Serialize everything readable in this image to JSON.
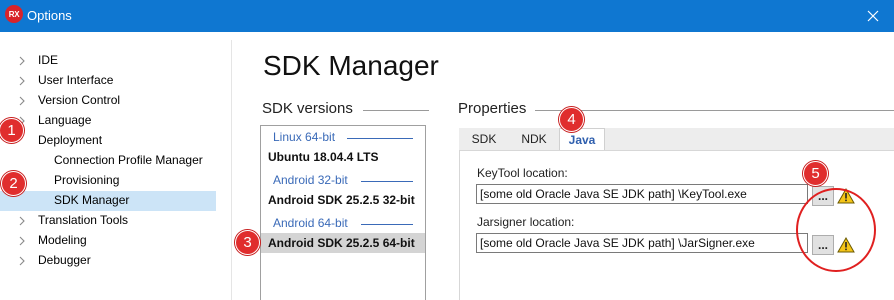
{
  "window": {
    "logo_text": "RX",
    "title": "Options"
  },
  "tree": {
    "items": [
      {
        "label": "IDE",
        "has_chevron": true
      },
      {
        "label": "User Interface",
        "has_chevron": true
      },
      {
        "label": "Version Control",
        "has_chevron": true
      },
      {
        "label": "Language",
        "has_chevron": true
      },
      {
        "label": "Deployment",
        "has_chevron": false
      },
      {
        "label": "Connection Profile Manager",
        "child": true
      },
      {
        "label": "Provisioning",
        "child": true
      },
      {
        "label": "SDK Manager",
        "child": true,
        "selected": true
      },
      {
        "label": "Translation Tools",
        "has_chevron": true
      },
      {
        "label": "Modeling",
        "has_chevron": true
      },
      {
        "label": "Debugger",
        "has_chevron": true
      }
    ]
  },
  "markers": [
    "1",
    "2",
    "3",
    "4",
    "5"
  ],
  "page": {
    "title": "SDK Manager"
  },
  "sdk_versions": {
    "heading": "SDK versions",
    "groups": [
      {
        "name": "Linux 64-bit",
        "items": [
          "Ubuntu 18.04.4 LTS"
        ]
      },
      {
        "name": "Android 32-bit",
        "items": [
          "Android SDK 25.2.5 32-bit"
        ]
      },
      {
        "name": "Android 64-bit",
        "items": [
          "Android SDK 25.2.5 64-bit"
        ]
      }
    ],
    "selected": "Android SDK 25.2.5 64-bit"
  },
  "properties": {
    "heading": "Properties",
    "tabs": [
      "SDK",
      "NDK",
      "Java"
    ],
    "active_tab": "Java",
    "fields": [
      {
        "label": "KeyTool location:",
        "value": "[some old Oracle Java SE JDK path] \\KeyTool.exe",
        "browse": "...",
        "warning": true
      },
      {
        "label": "Jarsigner location:",
        "value": "[some old Oracle Java SE JDK path] \\JarSigner.exe",
        "browse": "...",
        "warning": true
      }
    ]
  },
  "colors": {
    "titlebar": "#0f77d1",
    "selection": "#cce4f7",
    "marker": "#e02d2d",
    "group_label": "#3a6ab8",
    "warning": "#f5c518"
  }
}
